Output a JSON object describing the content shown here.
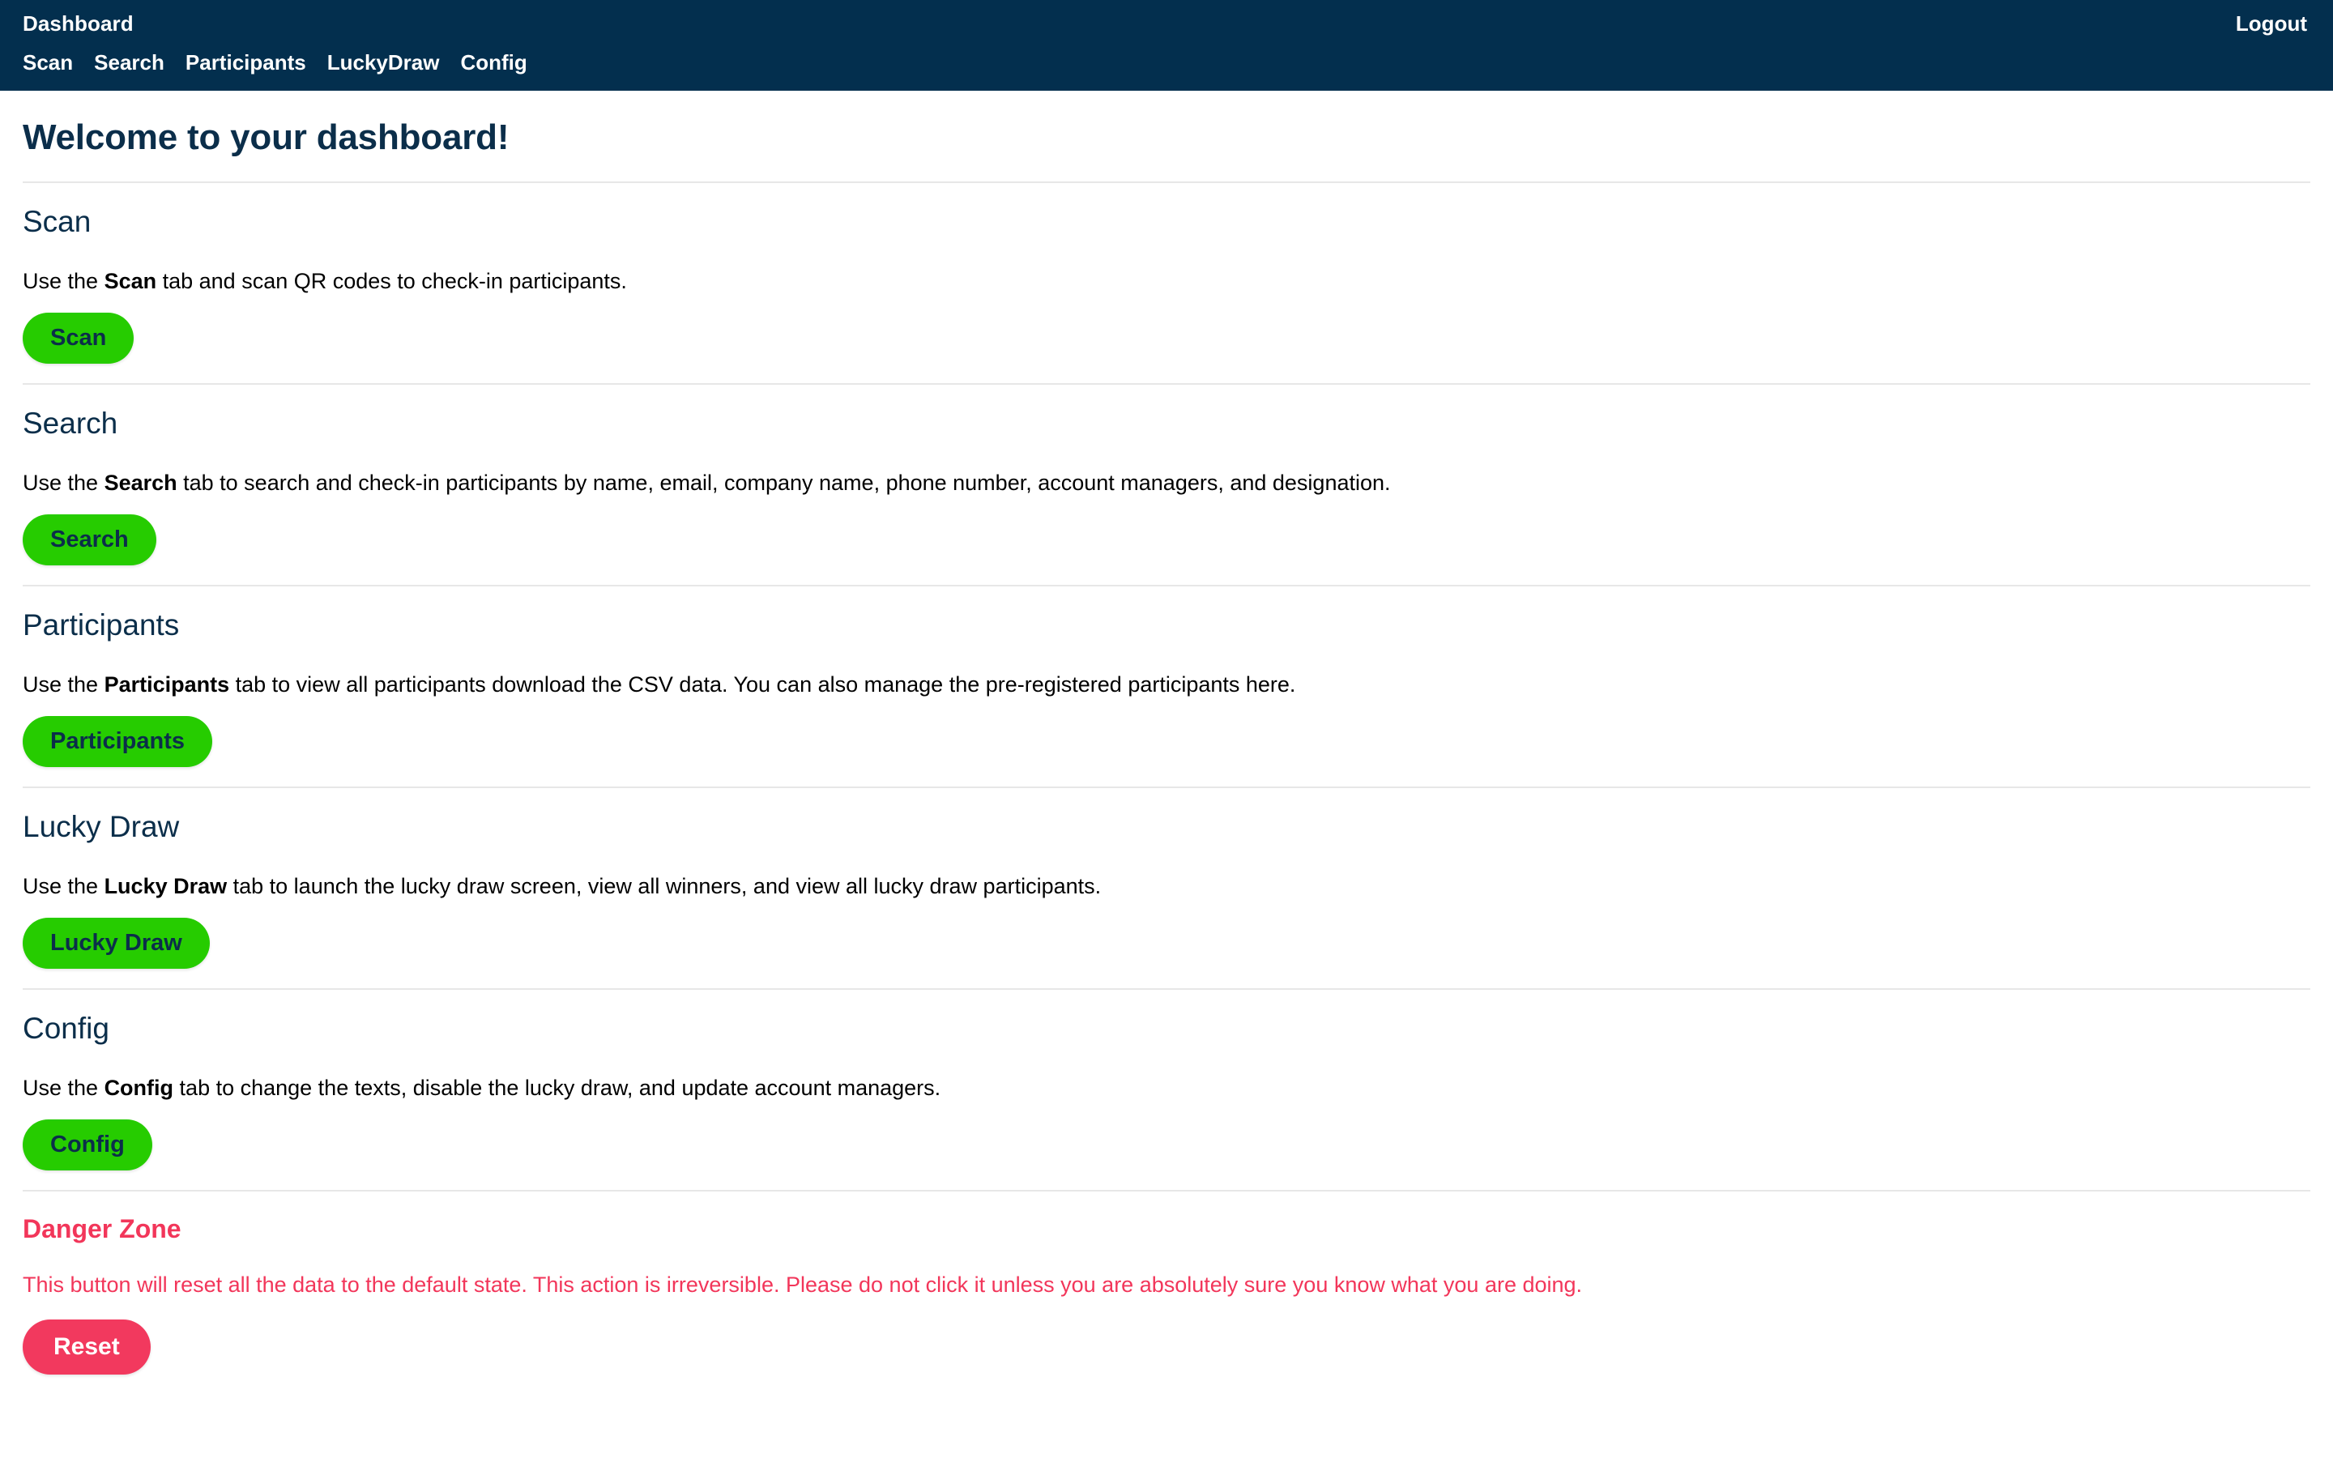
{
  "navbar": {
    "brand": "Dashboard",
    "logout_label": "Logout",
    "links": [
      {
        "label": "Scan"
      },
      {
        "label": "Search"
      },
      {
        "label": "Participants"
      },
      {
        "label": "LuckyDraw"
      },
      {
        "label": "Config"
      }
    ],
    "background_color": "#032f4e",
    "text_color": "#ffffff"
  },
  "page": {
    "title": "Welcome to your dashboard!"
  },
  "sections": [
    {
      "title": "Scan",
      "desc_pre": "Use the ",
      "desc_bold": "Scan",
      "desc_post": " tab and scan QR codes to check-in participants.",
      "button_label": "Scan"
    },
    {
      "title": "Search",
      "desc_pre": "Use the ",
      "desc_bold": "Search",
      "desc_post": " tab to search and check-in participants by name, email, company name, phone number, account managers, and designation.",
      "button_label": "Search"
    },
    {
      "title": "Participants",
      "desc_pre": "Use the ",
      "desc_bold": "Participants",
      "desc_post": " tab to view all participants download the CSV data. You can also manage the pre-registered participants here.",
      "button_label": "Participants"
    },
    {
      "title": "Lucky Draw",
      "desc_pre": "Use the ",
      "desc_bold": "Lucky Draw",
      "desc_post": " tab to launch the lucky draw screen, view all winners, and view all lucky draw participants.",
      "button_label": "Lucky Draw"
    },
    {
      "title": "Config",
      "desc_pre": "Use the ",
      "desc_bold": "Config",
      "desc_post": " tab to change the texts, disable the lucky draw, and update account managers.",
      "button_label": "Config"
    }
  ],
  "danger_zone": {
    "title": "Danger Zone",
    "description": "This button will reset all the data to the default state. This action is irreversible. Please do not click it unless you are absolutely sure you know what you are doing.",
    "button_label": "Reset",
    "color": "#f2365a"
  },
  "theme": {
    "navy": "#0b2e4a",
    "green": "#26cc00",
    "danger": "#f2365a",
    "divider": "#e7e7e7"
  }
}
